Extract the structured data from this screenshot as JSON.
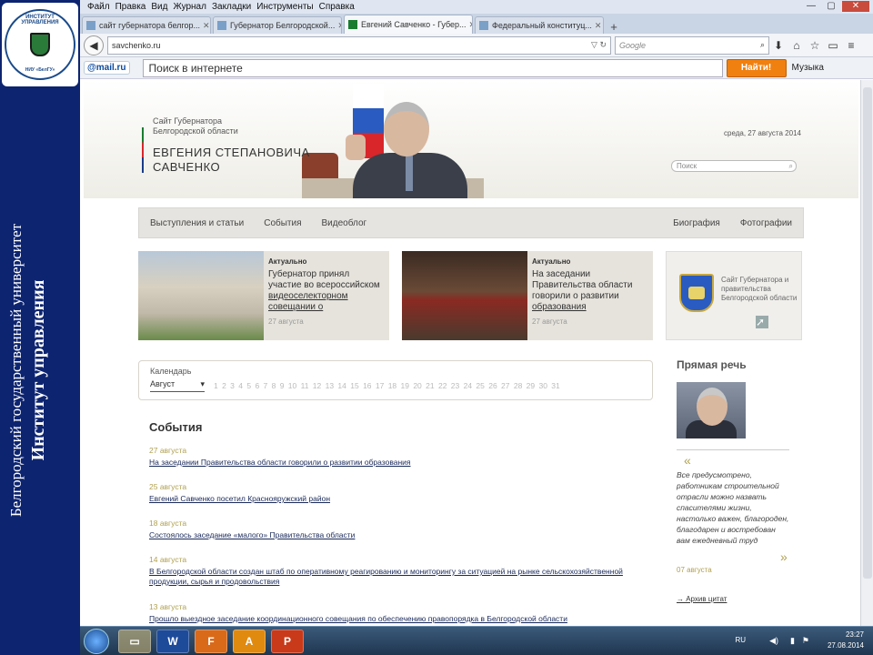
{
  "slide": {
    "university_line": "Белгородский государственный университет",
    "institute_line": "Институт управления",
    "logo_text_top": "ИНСТИТУТ УПРАВЛЕНИЯ",
    "logo_text_bottom": "НИУ «БелГУ»"
  },
  "browser": {
    "menu": [
      "Файл",
      "Правка",
      "Вид",
      "Журнал",
      "Закладки",
      "Инструменты",
      "Справка"
    ],
    "tabs": [
      {
        "label": "сайт губернатора белгор...",
        "active": false
      },
      {
        "label": "Губернатор Белгородской...",
        "active": false
      },
      {
        "label": "Евгений Савченко - Губер...",
        "active": true
      },
      {
        "label": "Федеральный конституц...",
        "active": false
      }
    ],
    "new_tab": "+",
    "url": "savchenko.ru",
    "search_engine_placeholder": "Google",
    "mail_brand": "@mail.ru",
    "mail_search_placeholder": "Поиск в интернете",
    "find_button": "Найти!",
    "music_button": "Музыка"
  },
  "site": {
    "subtitle_line1": "Сайт Губернатора",
    "subtitle_line2": "Белгородской области",
    "name_line1": "ЕВГЕНИЯ СТЕПАНОВИЧА",
    "name_line2": "САВЧЕНКО",
    "date": "среда, 27 августа 2014",
    "search_placeholder": "Поиск",
    "nav_left": [
      "Выступления и статьи",
      "События",
      "Видеоблог"
    ],
    "nav_right": [
      "Биография",
      "Фотографии"
    ],
    "card1": {
      "tag": "Актуально",
      "text": "Губернатор принял участие во всероссийском",
      "link": "видеоселекторном совещании о",
      "date": "27 августа"
    },
    "card2": {
      "tag": "Актуально",
      "text": "На заседании Правительства области говорили о развитии",
      "link": "образования",
      "date": "27 августа"
    },
    "card3": {
      "text": "Сайт Губернатора и правительства Белгородской области"
    },
    "calendar": {
      "label": "Календарь",
      "month": "Август",
      "days": "1 2 3 4 5 6 7 8 9 10 11 12 13 14 15 16 17 18 19 20 21 22 23 24 25 26 27 28 29 30 31"
    },
    "events_heading": "События",
    "events": [
      {
        "date": "27 августа",
        "title": "На заседании Правительства области говорили о развитии образования"
      },
      {
        "date": "25 августа",
        "title": "Евгений Савченко посетил Краснояружский район"
      },
      {
        "date": "18 августа",
        "title": "Состоялось заседание «малого» Правительства области"
      },
      {
        "date": "14 августа",
        "title": "В Белгородской области создан штаб по оперативному реагированию и мониторингу за ситуацией на рынке сельскохозяйственной продукции, сырья и продовольствия"
      },
      {
        "date": "13 августа",
        "title": "Прошло выездное заседание координационного совещания по обеспечению правопорядка в Белгородской области"
      }
    ],
    "direct_speech": {
      "heading": "Прямая речь",
      "quote": "Все предусмотрено, работникам строительной отрасли можно назвать спасителями жизни, настолько важен, благороден, благодарен и востребован вам ежедневный труд",
      "date": "07 августа",
      "all_link": "→ Архив цитат"
    }
  },
  "taskbar": {
    "lang": "RU",
    "time": "23:27",
    "date": "27.08.2014",
    "apps": [
      "W",
      "F",
      "A",
      "P"
    ]
  }
}
